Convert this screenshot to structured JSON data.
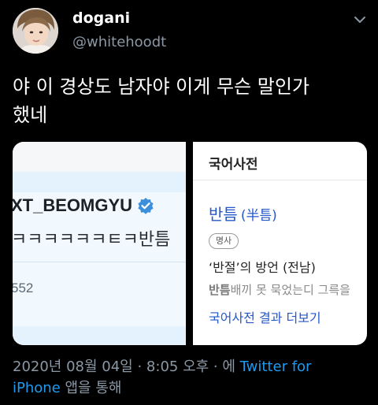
{
  "tweet": {
    "display_name": "dogani",
    "handle": "@whitehoodt",
    "text_line1": "야 이 경상도 남자야 이게 무슨 말인가",
    "text_line2": "했네"
  },
  "media_left": {
    "username": "XT_BEOMGYU",
    "message": "ㅋㅋㅋㅋㅋㅋㅌㅋ반틈",
    "number": "552"
  },
  "media_right": {
    "section_title": "국어사전",
    "entry_word": "반틈",
    "entry_hanja": "(半틈)",
    "pos_badge": "명사",
    "definition": "‘반절’의 방언 (전남)",
    "example_bold": "반틈",
    "example_rest": "배끼 못 묵었는디 그륵을",
    "more_link": "국어사전 결과 더보기"
  },
  "footer": {
    "date": "2020년 08월 04일",
    "dot1": " · ",
    "time": "8:05 오후",
    "dot2": " · 에 ",
    "source_part1": "Twitter for",
    "source_part2": "iPhone",
    "suffix": " 앱을 통해"
  },
  "colors": {
    "background": "#000000",
    "secondary_text": "#8b98a5",
    "link_blue": "#1d9bf0",
    "dict_blue": "#2457c8",
    "verified_blue": "#3d8fdc"
  },
  "icons": {
    "more": "more-dots-icon",
    "verified": "verified-badge-icon"
  }
}
